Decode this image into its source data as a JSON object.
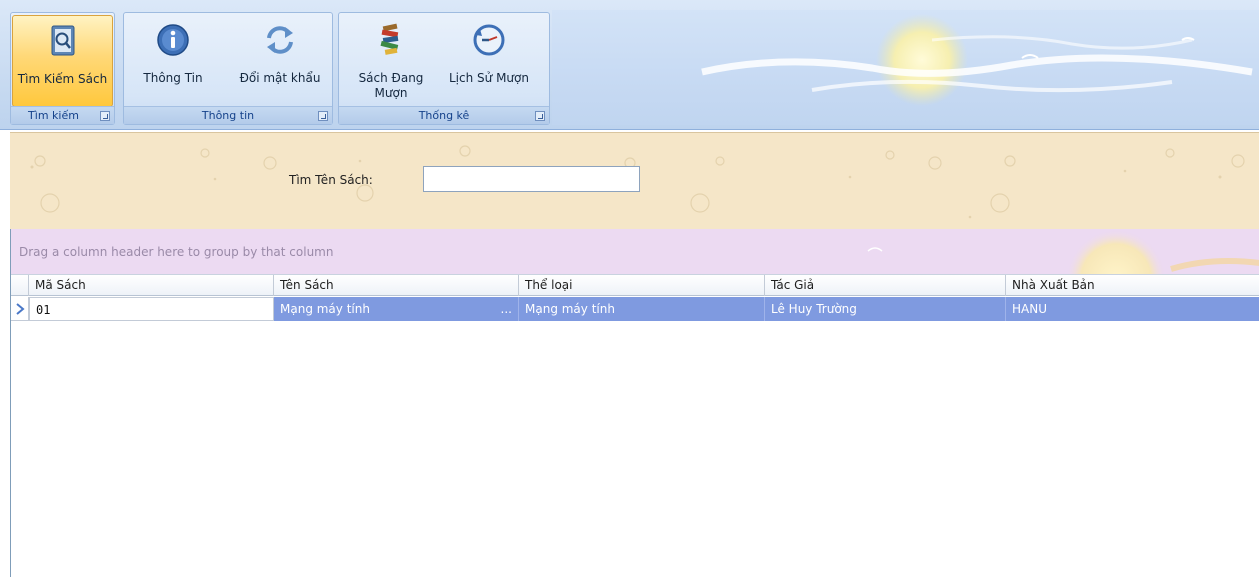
{
  "ribbon": {
    "groups": [
      {
        "label": "Tìm kiếm",
        "buttons": [
          {
            "label": "Tìm Kiếm Sách",
            "icon": "search-book-icon",
            "active": true
          }
        ]
      },
      {
        "label": "Thông tin",
        "buttons": [
          {
            "label": "Thông Tin",
            "icon": "info-icon"
          },
          {
            "label": "Đổi mật khẩu",
            "icon": "refresh-arrows-icon"
          }
        ]
      },
      {
        "label": "Thống kê",
        "buttons": [
          {
            "label": "Sách Đang Mượn",
            "icon": "book-stack-icon"
          },
          {
            "label": "Lịch Sử Mượn",
            "icon": "history-clock-icon"
          }
        ]
      }
    ]
  },
  "search": {
    "label": "Tìm Tên Sách:",
    "value": "",
    "placeholder": ""
  },
  "grid": {
    "group_hint": "Drag a column header here to group by that column",
    "columns": [
      "Mã Sách",
      "Tên Sách",
      "Thể loại",
      "Tác Giả",
      "Nhà Xuất Bản"
    ],
    "rows": [
      [
        "01",
        "Mạng máy tính",
        "Mạng máy tính",
        "Lê Huy Trường",
        "HANU"
      ]
    ],
    "ellipsis": "..."
  },
  "colors": {
    "ribbon_bg": "#cadcf2",
    "active_button": "#ffd877",
    "search_panel_bg": "#f5e6c8",
    "group_panel_bg": "#ecdaf2",
    "selected_row": "#7f9ae0"
  }
}
